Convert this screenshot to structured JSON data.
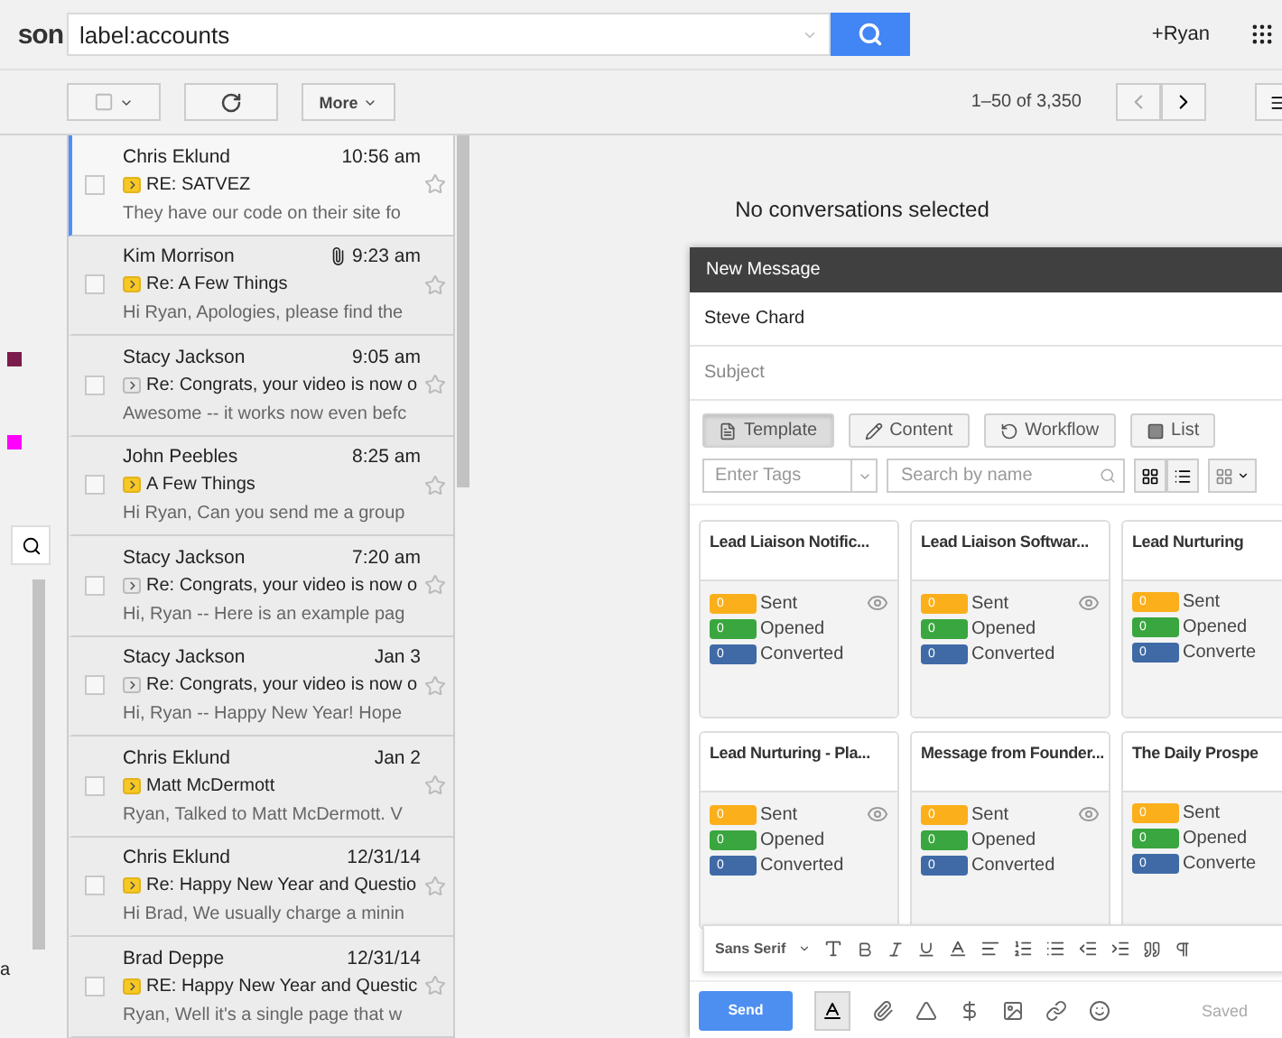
{
  "logo": {
    "text": "son"
  },
  "search": {
    "value": "label:accounts"
  },
  "account": {
    "name": "+Ryan"
  },
  "toolbar": {
    "more": "More",
    "range": "1–50 of 3,350"
  },
  "sidebar": {
    "labels": [
      {
        "color": "#7b1c4b"
      },
      {
        "color": "#ff00ff"
      }
    ],
    "footer_text": "a"
  },
  "emails": [
    {
      "sender": "Chris Eklund",
      "time": "10:56 am",
      "subject": "RE: SATVEZ",
      "snippet": "They have our code on their site fo",
      "important": true,
      "attachment": false,
      "selected": true
    },
    {
      "sender": "Kim Morrison",
      "time": "9:23 am",
      "subject": "Re: A Few Things",
      "snippet": "Hi Ryan, Apologies, please find the",
      "important": true,
      "attachment": true,
      "selected": false
    },
    {
      "sender": "Stacy Jackson",
      "time": "9:05 am",
      "subject": "Re: Congrats, your video is now o",
      "snippet": "Awesome -- it works now even befc",
      "important": false,
      "attachment": false,
      "selected": false
    },
    {
      "sender": "John Peebles",
      "time": "8:25 am",
      "subject": "A Few Things",
      "snippet": "Hi Ryan, Can you send me a group",
      "important": true,
      "attachment": false,
      "selected": false
    },
    {
      "sender": "Stacy Jackson",
      "time": "7:20 am",
      "subject": "Re: Congrats, your video is now o",
      "snippet": "Hi, Ryan -- Here is an example pag",
      "important": false,
      "attachment": false,
      "selected": false
    },
    {
      "sender": "Stacy Jackson",
      "time": "Jan 3",
      "subject": "Re: Congrats, your video is now o",
      "snippet": "Hi, Ryan -- Happy New Year! Hope",
      "important": false,
      "attachment": false,
      "selected": false
    },
    {
      "sender": "Chris Eklund",
      "time": "Jan 2",
      "subject": "Matt McDermott",
      "snippet": "Ryan, Talked to Matt McDermott. V",
      "important": true,
      "attachment": false,
      "selected": false
    },
    {
      "sender": "Chris Eklund",
      "time": "12/31/14",
      "subject": "Re: Happy New Year and Questio",
      "snippet": "Hi Brad, We usually charge a minin",
      "important": true,
      "attachment": false,
      "selected": false
    },
    {
      "sender": "Brad Deppe",
      "time": "12/31/14",
      "subject": "RE: Happy New Year and Questic",
      "snippet": "Ryan, Well it's a single page that w",
      "important": true,
      "attachment": false,
      "selected": false
    }
  ],
  "reading_pane": {
    "empty_text": "No conversations selected"
  },
  "compose": {
    "title": "New Message",
    "to": "Steve Chard",
    "subject_placeholder": "Subject",
    "tabs": [
      {
        "label": "Template",
        "kind": "template",
        "selected": true
      },
      {
        "label": "Content",
        "kind": "content",
        "selected": false
      },
      {
        "label": "Workflow",
        "kind": "workflow",
        "selected": false
      },
      {
        "label": "List",
        "kind": "list",
        "selected": false
      }
    ],
    "tag_placeholder": "Enter Tags",
    "search_placeholder": "Search by name",
    "cards": [
      {
        "title": "Lead Liaison Notific...",
        "viewable": true,
        "stats": [
          {
            "value": "0",
            "label": "Sent",
            "color": "#fbaf1a"
          },
          {
            "value": "0",
            "label": "Opened",
            "color": "#3aa63f"
          },
          {
            "value": "0",
            "label": "Converted",
            "color": "#3f6aa6"
          }
        ]
      },
      {
        "title": "Lead Liaison Softwar...",
        "viewable": true,
        "stats": [
          {
            "value": "0",
            "label": "Sent",
            "color": "#fbaf1a"
          },
          {
            "value": "0",
            "label": "Opened",
            "color": "#3aa63f"
          },
          {
            "value": "0",
            "label": "Converted",
            "color": "#3f6aa6"
          }
        ]
      },
      {
        "title": "Lead Nurturing",
        "viewable": false,
        "stats": [
          {
            "value": "0",
            "label": "Sent",
            "color": "#fbaf1a"
          },
          {
            "value": "0",
            "label": "Opened",
            "color": "#3aa63f"
          },
          {
            "value": "0",
            "label": "Converte",
            "color": "#3f6aa6"
          }
        ]
      },
      {
        "title": "Lead Nurturing - Pla...",
        "viewable": true,
        "stats": [
          {
            "value": "0",
            "label": "Sent",
            "color": "#fbaf1a"
          },
          {
            "value": "0",
            "label": "Opened",
            "color": "#3aa63f"
          },
          {
            "value": "0",
            "label": "Converted",
            "color": "#3f6aa6"
          }
        ]
      },
      {
        "title": "Message from Founder...",
        "viewable": true,
        "stats": [
          {
            "value": "0",
            "label": "Sent",
            "color": "#fbaf1a"
          },
          {
            "value": "0",
            "label": "Opened",
            "color": "#3aa63f"
          },
          {
            "value": "0",
            "label": "Converted",
            "color": "#3f6aa6"
          }
        ]
      },
      {
        "title": "The Daily Prospe",
        "viewable": false,
        "stats": [
          {
            "value": "0",
            "label": "Sent",
            "color": "#fbaf1a"
          },
          {
            "value": "0",
            "label": "Opened",
            "color": "#3aa63f"
          },
          {
            "value": "0",
            "label": "Converte",
            "color": "#3f6aa6"
          }
        ]
      }
    ],
    "format_font": "Sans Serif",
    "send": "Send",
    "status": "Saved"
  }
}
